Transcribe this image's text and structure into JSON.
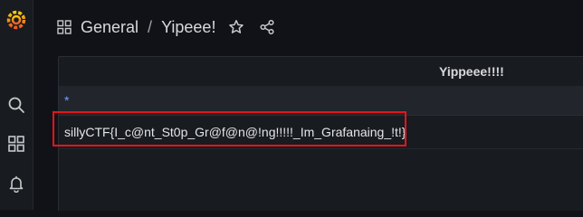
{
  "sidebar": {
    "items": [
      {
        "icon": "grafana-logo-icon"
      },
      {
        "icon": "search-icon"
      },
      {
        "icon": "dashboards-icon"
      },
      {
        "icon": "bell-icon"
      }
    ]
  },
  "header": {
    "breadcrumb": {
      "folder": "General",
      "separator": "/",
      "dashboard": "Yipeee!"
    }
  },
  "panel": {
    "title": "Yippeee!!!!",
    "table": {
      "columns": [
        "*"
      ],
      "rows": [
        [
          "sillyCTF{I_c@nt_St0p_Gr@f@n@!ng!!!!!_Im_Grafanaing_!t!}"
        ]
      ]
    }
  },
  "colors": {
    "background": "#111217",
    "panel": "#181b1f",
    "accent_orange": "#f05a28",
    "link_blue": "#6e9fff",
    "highlight_red": "#e5141c"
  }
}
